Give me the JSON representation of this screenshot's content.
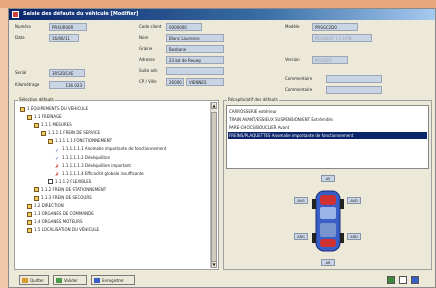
{
  "window": {
    "title": "Saisie des défauts du véhicule [Modifier]"
  },
  "form": {
    "numero_label": "Numéro",
    "numero_value": "PR4UR00R",
    "date_label": "Date",
    "date_value": "16/06/11",
    "codeclient_label": "Code client",
    "codeclient_value": "0000000",
    "nom_label": "Nom",
    "nom_value": "Blanc Laurence",
    "graine_label": "Graine",
    "graine_value": "Bosbane",
    "adresse_label": "Adresse",
    "adresse_value": "23 bd de Reuwy",
    "suite_label": "Suite adr.",
    "suite_value": "",
    "cpville_label": "CP / Ville",
    "cp_value": "26000",
    "ville_value": "VIENNES",
    "modele_label": "Modèle",
    "modele_value": "PRSGC2D0",
    "marque_label": "Marque",
    "marque_value": "PEUGEOT 1.5 HTN",
    "version_label": "Version",
    "version_value": "PEUGEO",
    "serial_label": "Serial",
    "serial_value": "3R52DC4E",
    "kilometrage_label": "Kilométrage",
    "kilometrage_value": "136 023",
    "comment1_label": "Commentaire",
    "comment2_label": "Commentaire"
  },
  "tree": {
    "title": "Sélection défauts",
    "items": [
      {
        "text": "1 ÉQUIPEMENTS DU VÉHICULE",
        "level": 0,
        "icon": "folder"
      },
      {
        "text": "1.1 FREINAGE",
        "level": 1,
        "icon": "folder"
      },
      {
        "text": "1.1.1 MESURES",
        "level": 2,
        "icon": "folder"
      },
      {
        "text": "1.1.1.1 FREIN DE SERVICE",
        "level": 3,
        "icon": "folder"
      },
      {
        "text": "1.1.1.1.1 FONCTIONNEMENT",
        "level": 4,
        "icon": "folder"
      },
      {
        "text": "1.1.1.1.1.1 Anomalie importante de fonctionnement",
        "level": 5,
        "icon": "check"
      },
      {
        "text": "1.1.1.1.1.2 Déséquilibre",
        "level": 5,
        "icon": "check"
      },
      {
        "text": "1.1.1.1.1.3 Déséquilibre important",
        "level": 5,
        "icon": "x"
      },
      {
        "text": "1.1.1.1.1.4 Efficacité globale insuffisante",
        "level": 5,
        "icon": "x"
      },
      {
        "text": "1.1.1.2 FLEXIBLES",
        "level": 4,
        "icon": "square"
      },
      {
        "text": "1.1.2 FREIN DE STATIONNEMENT",
        "level": 2,
        "icon": "folder"
      },
      {
        "text": "1.1.3 FREIN DE SECOURS",
        "level": 2,
        "icon": "folder"
      },
      {
        "text": "1.2 DIRECTION",
        "level": 1,
        "icon": "folder"
      },
      {
        "text": "1.3 ORGANES DE COMMANDE",
        "level": 1,
        "icon": "folder"
      },
      {
        "text": "1.4 ORGANES MOTEURS",
        "level": 1,
        "icon": "folder"
      },
      {
        "text": "1.5 LOCALISATION DU VÉHICULE",
        "level": 1,
        "icon": "folder"
      }
    ]
  },
  "defects": {
    "title": "Récapitulatif des défauts",
    "items": [
      {
        "text": "CARROSSERIE extérieur",
        "selected": false
      },
      {
        "text": "TRAIN AVANT/ESSIEUX SUSPENSION/ENT Extrémités",
        "selected": false
      },
      {
        "text": "PARE-CHOCS/BOUCLIER Avant",
        "selected": false
      },
      {
        "text": "FREINS/PLAQUETTES Anomalie importante de fonctionnement",
        "selected": true
      }
    ]
  },
  "tires": {
    "avg": "AVG",
    "avd": "AVD",
    "arg": "ARG",
    "ard": "ARD",
    "av": "AV",
    "ar": "AR"
  },
  "toolbar": {
    "btn1": "Quitter",
    "btn2": "Valider",
    "btn3": "Enregistrer"
  },
  "colors": {
    "titlebar": "#0a246a",
    "selected": "#0a246a",
    "field": "#c9d4e4",
    "car": "#3a5ec8",
    "car_accent": "#d03030"
  }
}
